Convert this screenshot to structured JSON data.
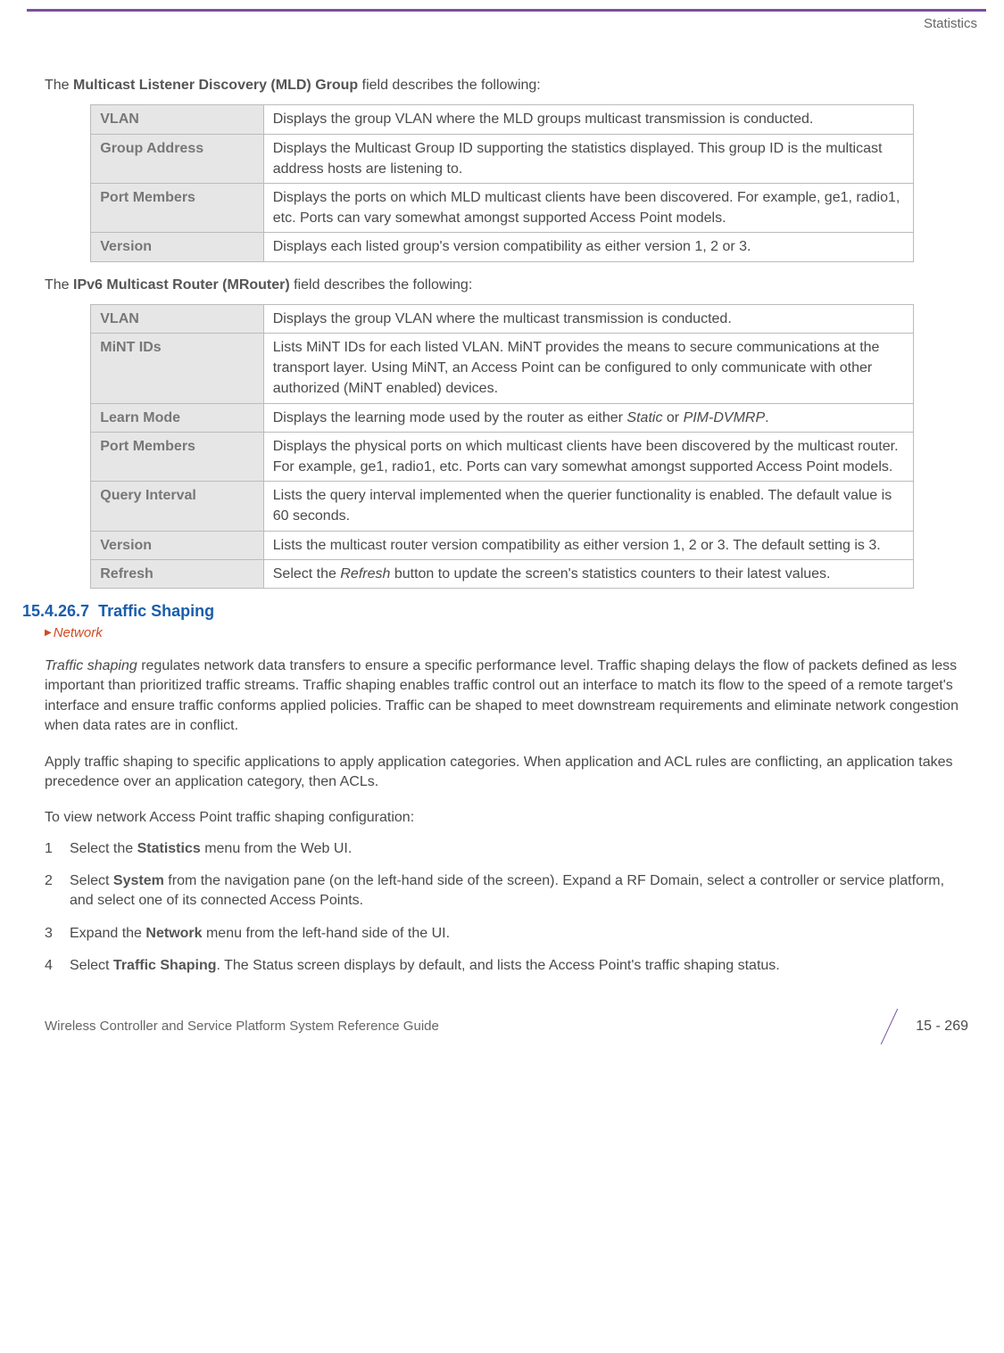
{
  "header": {
    "section_name": "Statistics"
  },
  "intro1": {
    "prefix": "The ",
    "bold": "Multicast Listener Discovery (MLD) Group",
    "suffix": " field describes the following:"
  },
  "table1": {
    "rows": [
      {
        "label": "VLAN",
        "desc": "Displays the group VLAN where the MLD groups multicast transmission is conducted."
      },
      {
        "label": "Group Address",
        "desc": "Displays the Multicast Group ID supporting the statistics displayed. This group ID is the multicast address hosts are listening to."
      },
      {
        "label": "Port Members",
        "desc": "Displays the ports on which MLD multicast clients have been discovered. For example, ge1, radio1, etc. Ports can vary somewhat amongst supported Access Point models."
      },
      {
        "label": "Version",
        "desc": "Displays each listed group's version compatibility as either version 1, 2 or 3."
      }
    ]
  },
  "intro2": {
    "prefix": "The ",
    "bold": "IPv6 Multicast Router (MRouter)",
    "suffix": " field describes the following:"
  },
  "table2": {
    "rows": [
      {
        "label": "VLAN",
        "desc": "Displays the group VLAN where the multicast transmission is conducted."
      },
      {
        "label": "MiNT IDs",
        "desc": "Lists MiNT IDs for each listed VLAN. MiNT provides the means to secure communications at the transport layer. Using MiNT, an Access Point can be configured to only communicate with other authorized (MiNT enabled) devices."
      },
      {
        "label": "Learn Mode",
        "desc_pre": "Displays the learning mode used by the router as either ",
        "italic1": "Static",
        "mid": " or ",
        "italic2": "PIM-DVMRP",
        "desc_post": "."
      },
      {
        "label": "Port Members",
        "desc": "Displays the physical ports on which multicast clients have been discovered by the multicast router. For example, ge1, radio1, etc. Ports can vary somewhat amongst supported Access Point models."
      },
      {
        "label": "Query Interval",
        "desc": "Lists the query interval implemented when the querier functionality is enabled. The default value is 60 seconds."
      },
      {
        "label": "Version",
        "desc": "Lists the multicast router version compatibility as either version 1, 2 or 3. The default setting is 3."
      },
      {
        "label": "Refresh",
        "desc_pre": "Select the ",
        "italic1": "Refresh",
        "desc_post": " button to update the screen's statistics counters to their latest values."
      }
    ]
  },
  "section": {
    "number": "15.4.26.7",
    "title": "Traffic Shaping",
    "network_label": "Network"
  },
  "body": {
    "para1_italic": "Traffic shaping",
    "para1_rest": " regulates network data transfers to ensure a specific performance level. Traffic shaping delays the flow of packets defined as less important than prioritized traffic streams. Traffic shaping enables traffic control out an interface to match its flow to the speed of a remote target's interface and ensure traffic conforms applied policies. Traffic can be shaped to meet downstream requirements and eliminate network congestion when data rates are in conflict.",
    "para2": "Apply traffic shaping to specific applications to apply application categories. When application and ACL rules are conflicting, an application takes precedence over an application category, then ACLs.",
    "para3": "To view network Access Point traffic shaping configuration:",
    "steps": [
      {
        "pre": "Select the ",
        "bold": "Statistics",
        "post": " menu from the Web UI."
      },
      {
        "pre": "Select ",
        "bold": "System",
        "post": " from the navigation pane (on the left-hand side of the screen). Expand a RF Domain, select a controller or service platform, and select one of its connected Access Points."
      },
      {
        "pre": "Expand the ",
        "bold": "Network",
        "post": " menu from the left-hand side of the UI."
      },
      {
        "pre": "Select ",
        "bold": "Traffic Shaping",
        "post": ". The Status screen displays by default, and lists the Access Point's traffic shaping status."
      }
    ]
  },
  "footer": {
    "left": "Wireless Controller and Service Platform System Reference Guide",
    "page": "15 - 269"
  }
}
